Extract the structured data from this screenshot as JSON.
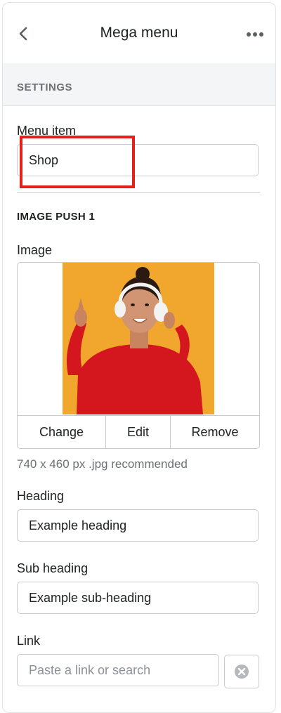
{
  "header": {
    "title": "Mega menu",
    "back_icon": "chevron-left-icon",
    "more_icon": "horizontal-dots-icon"
  },
  "section": {
    "label": "SETTINGS"
  },
  "menu_item": {
    "label": "Menu item",
    "value": "Shop"
  },
  "image_push": {
    "heading": "IMAGE PUSH 1",
    "image_label": "Image",
    "actions": [
      "Change",
      "Edit",
      "Remove"
    ],
    "help_text": "740 x 460 px .jpg recommended"
  },
  "heading_field": {
    "label": "Heading",
    "value": "Example heading"
  },
  "subheading_field": {
    "label": "Sub heading",
    "value": "Example sub-heading"
  },
  "link_field": {
    "label": "Link",
    "placeholder": "Paste a link or search",
    "clear_icon": "clear-circle-icon"
  },
  "colors": {
    "highlight": "#e32119",
    "image_background": "#f1a72d",
    "sweater": "#d4161f"
  }
}
